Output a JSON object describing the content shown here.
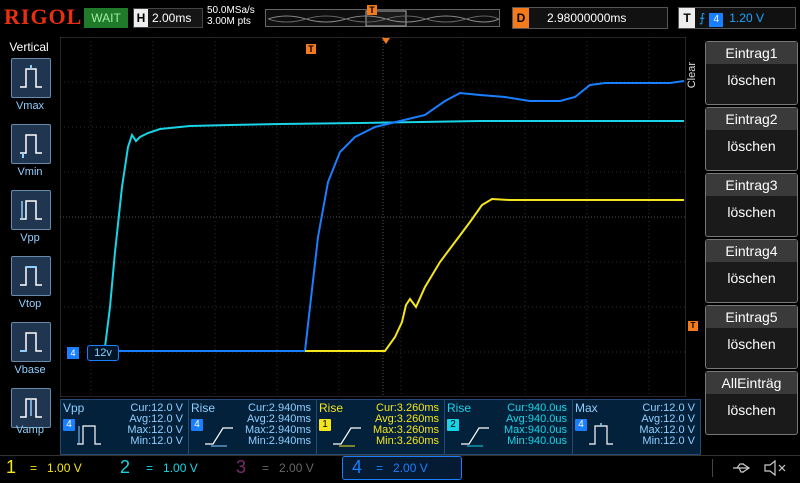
{
  "header": {
    "brand": "RIGOL",
    "run_status": "WAIT",
    "horizontal_key": "H",
    "timebase": "2.00ms",
    "sample_rate": "50.0MSa/s",
    "mem_depth": "3.00M pts",
    "trigger_marker": "T",
    "delay_key": "D",
    "delay": "2.98000000ms",
    "trigger_key": "T",
    "trigger_source": "4",
    "trigger_level": "1.20 V"
  },
  "left_menu": {
    "title": "Vertical",
    "items": [
      {
        "label": "Vmax"
      },
      {
        "label": "Vmin"
      },
      {
        "label": "Vpp"
      },
      {
        "label": "Vtop"
      },
      {
        "label": "Vbase"
      },
      {
        "label": "Vamp"
      }
    ]
  },
  "right_menu": {
    "clear_label": "Clear",
    "items": [
      {
        "title": "Eintrag1",
        "action": "löschen"
      },
      {
        "title": "Eintrag2",
        "action": "löschen"
      },
      {
        "title": "Eintrag3",
        "action": "löschen"
      },
      {
        "title": "Eintrag4",
        "action": "löschen"
      },
      {
        "title": "Eintrag5",
        "action": "löschen"
      },
      {
        "title": "AllEinträg",
        "action": "löschen"
      }
    ]
  },
  "scope": {
    "ch4_marker": "4",
    "ch4_offset_label": "12v",
    "trigger_level_marker": "T"
  },
  "measurements": [
    {
      "name": "Vpp",
      "channel": "4",
      "cur": "Cur:12.0 V",
      "avg": "Avg:12.0 V",
      "max": "Max:12.0 V",
      "min": "Min:12.0 V"
    },
    {
      "name": "Rise",
      "channel": "4",
      "cur": "Cur:2.940ms",
      "avg": "Avg:2.940ms",
      "max": "Max:2.940ms",
      "min": "Min:2.940ms"
    },
    {
      "name": "Rise",
      "channel": "1",
      "cur": "Cur:3.260ms",
      "avg": "Avg:3.260ms",
      "max": "Max:3.260ms",
      "min": "Min:3.260ms"
    },
    {
      "name": "Rise",
      "channel": "2",
      "cur": "Cur:940.0us",
      "avg": "Avg:940.0us",
      "max": "Max:940.0us",
      "min": "Min:940.0us"
    },
    {
      "name": "Max",
      "channel": "4",
      "cur": "Cur:12.0 V",
      "avg": "Avg:12.0 V",
      "max": "Max:12.0 V",
      "min": "Min:12.0 V"
    }
  ],
  "channels": [
    {
      "num": "1",
      "scale": "1.00 V",
      "color": "#f5e51c"
    },
    {
      "num": "2",
      "scale": "1.00 V",
      "color": "#19d4e6"
    },
    {
      "num": "3",
      "scale": "2.00 V",
      "color": "#c030a8"
    },
    {
      "num": "4",
      "scale": "2.00 V",
      "color": "#1a7fff"
    }
  ],
  "colors": {
    "ch1": "#f5e51c",
    "ch2": "#19d4e6",
    "ch4": "#1a7fff",
    "accent": "#f47a1b"
  }
}
